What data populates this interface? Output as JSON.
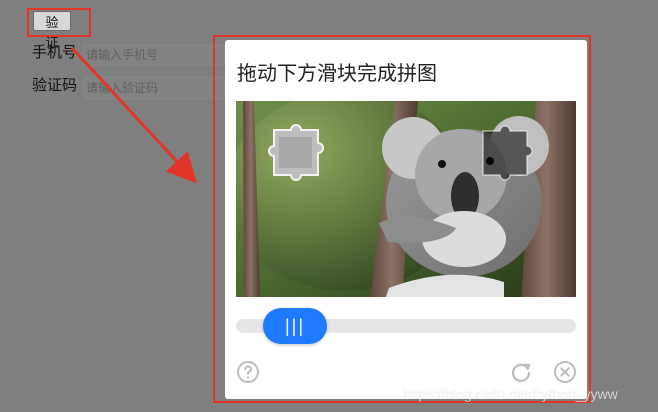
{
  "verify": {
    "button_label": "验证"
  },
  "form": {
    "phone_label": "手机号",
    "phone_placeholder": "请输入手机号",
    "code_label": "验证码",
    "code_placeholder": "请输入验证码"
  },
  "modal": {
    "title": "拖动下方滑块完成拼图",
    "slider_grip": "|||"
  },
  "icons": {
    "help": "help-icon",
    "refresh": "refresh-icon",
    "close": "close-icon"
  },
  "watermark": "https://blog.csdn.net/Python_yyww",
  "colors": {
    "annotation_red": "#e2352a",
    "slider_blue": "#1e7bff",
    "overlay_gray": "#7f7f7f"
  }
}
